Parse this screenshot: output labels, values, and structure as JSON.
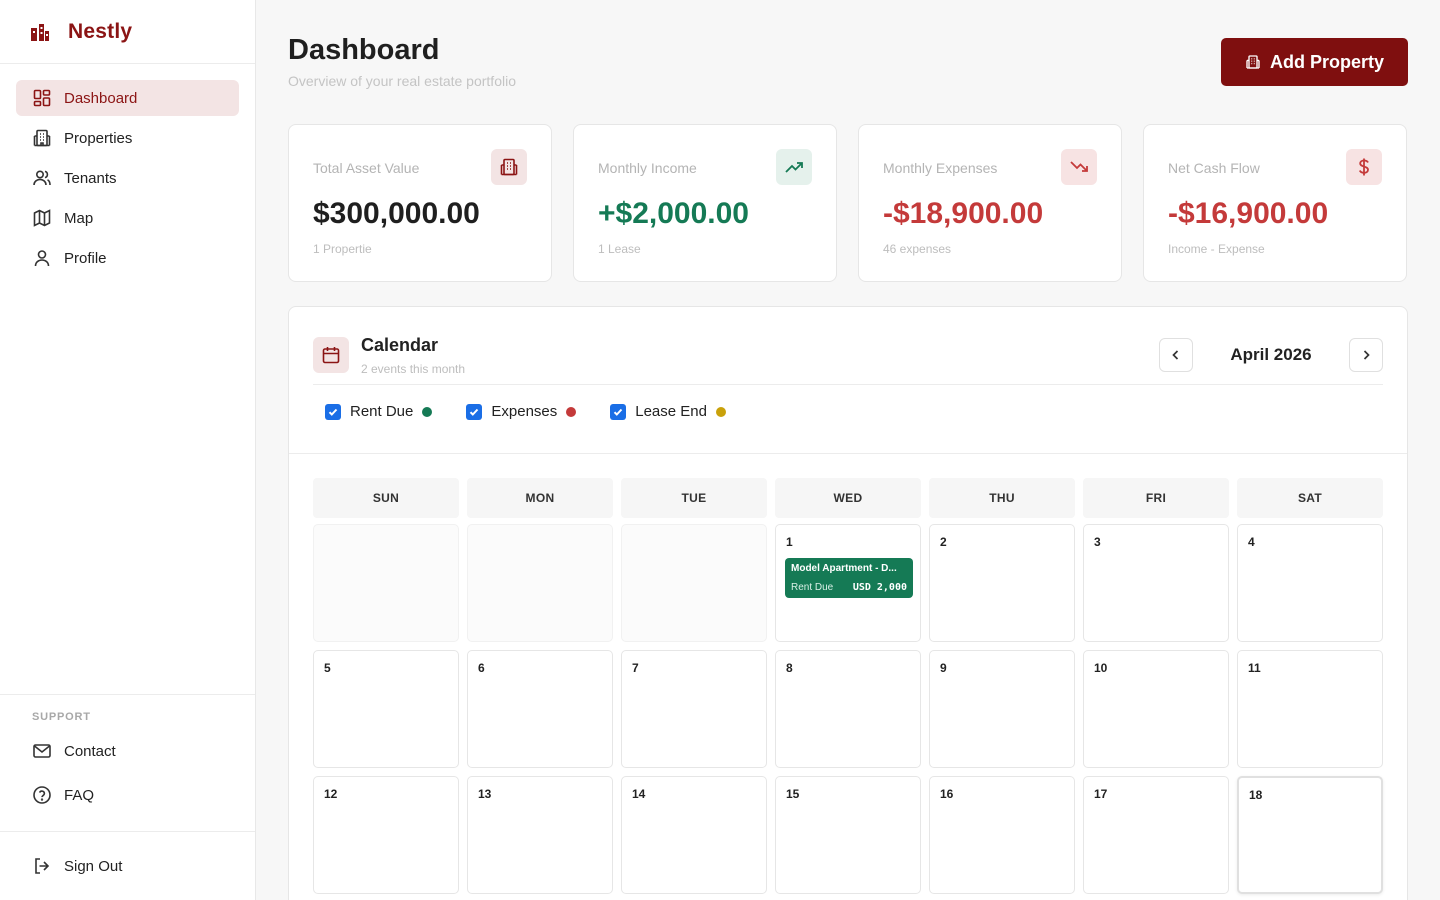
{
  "brand": {
    "name": "Nestly",
    "logo": "building-logo-icon"
  },
  "sidebar": {
    "items": [
      {
        "label": "Dashboard",
        "icon": "dashboard-grid-icon",
        "active": true
      },
      {
        "label": "Properties",
        "icon": "building-icon"
      },
      {
        "label": "Tenants",
        "icon": "users-icon"
      },
      {
        "label": "Map",
        "icon": "map-icon"
      },
      {
        "label": "Profile",
        "icon": "user-icon"
      }
    ],
    "support_title": "SUPPORT",
    "support_items": [
      {
        "label": "Contact",
        "icon": "mail-icon"
      },
      {
        "label": "FAQ",
        "icon": "help-circle-icon"
      }
    ],
    "signout_label": "Sign Out"
  },
  "header": {
    "title": "Dashboard",
    "subtitle": "Overview of your real estate portfolio",
    "add_button": "Add Property"
  },
  "stats": [
    {
      "label": "Total Asset Value",
      "value": "$300,000.00",
      "sub": "1 Propertie",
      "icon": "building-icon",
      "color": "#1f1f1f",
      "icon_bg": "#f3e4e4",
      "icon_color": "#8b1414"
    },
    {
      "label": "Monthly Income",
      "value": "+$2,000.00",
      "sub": "1 Lease",
      "icon": "trending-up-icon",
      "color": "#157a55",
      "icon_bg": "#e5f1ec",
      "icon_color": "#157a55"
    },
    {
      "label": "Monthly Expenses",
      "value": "-$18,900.00",
      "sub": "46 expenses",
      "icon": "trending-down-icon",
      "color": "#c43a3a",
      "icon_bg": "#f7e3e3",
      "icon_color": "#c43a3a"
    },
    {
      "label": "Net Cash Flow",
      "value": "-$16,900.00",
      "sub": "Income - Expense",
      "icon": "dollar-icon",
      "color": "#c43a3a",
      "icon_bg": "#f7e3e3",
      "icon_color": "#c43a3a"
    }
  ],
  "calendar": {
    "title": "Calendar",
    "subtitle": "2 events this month",
    "month": "April 2026",
    "filters": [
      {
        "label": "Rent Due",
        "checked": true,
        "color": "#157a55"
      },
      {
        "label": "Expenses",
        "checked": true,
        "color": "#c43a3a"
      },
      {
        "label": "Lease End",
        "checked": true,
        "color": "#c9a10a"
      }
    ],
    "weekdays": [
      "SUN",
      "MON",
      "TUE",
      "WED",
      "THU",
      "FRI",
      "SAT"
    ],
    "weeks": [
      [
        "",
        "",
        "",
        "1",
        "2",
        "3",
        "4"
      ],
      [
        "5",
        "6",
        "7",
        "8",
        "9",
        "10",
        "11"
      ],
      [
        "12",
        "13",
        "14",
        "15",
        "16",
        "17",
        "18"
      ]
    ],
    "today": "18",
    "events": [
      {
        "day": "1",
        "title": "Model Apartment - D...",
        "type": "Rent Due",
        "amount": "USD 2,000",
        "color": "#157a55"
      }
    ]
  }
}
